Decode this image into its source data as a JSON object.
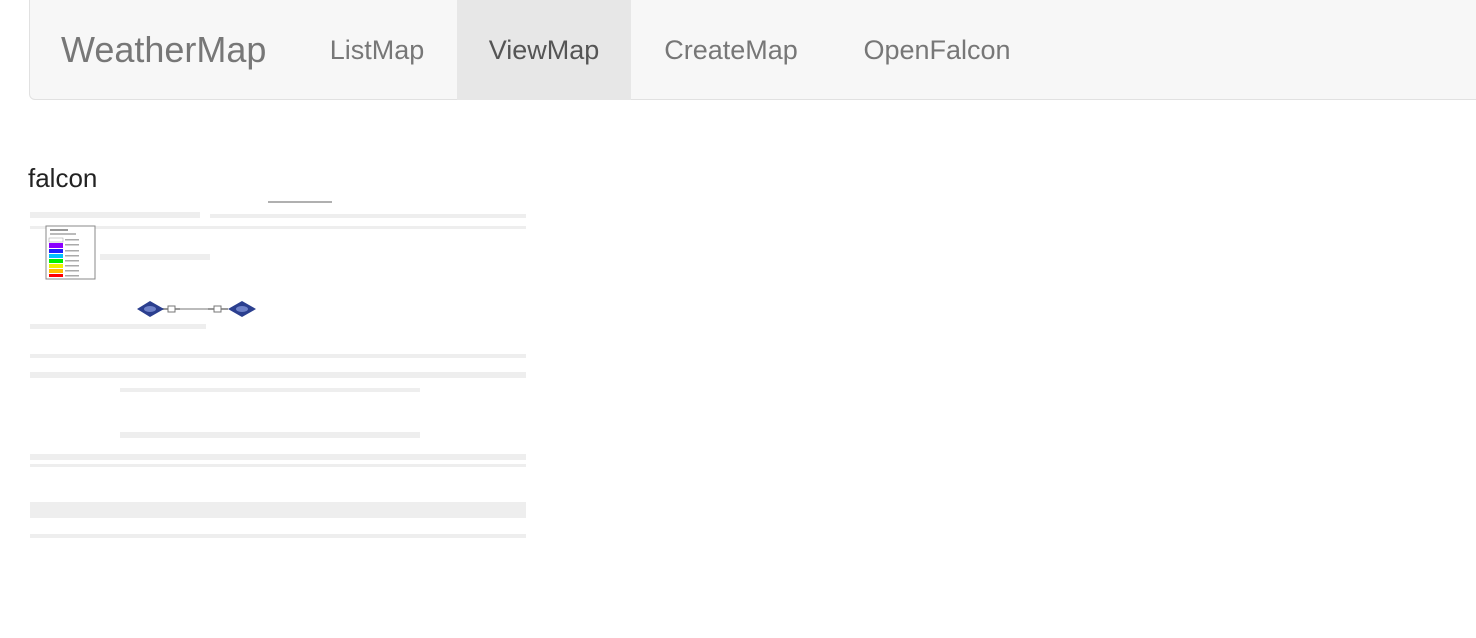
{
  "navbar": {
    "brand": "WeatherMap",
    "items": [
      {
        "label": "ListMap",
        "active": false
      },
      {
        "label": "ViewMap",
        "active": true
      },
      {
        "label": "CreateMap",
        "active": false
      },
      {
        "label": "OpenFalcon",
        "active": false
      }
    ],
    "background": "#f7f7f7",
    "active_background": "#e7e7e7"
  },
  "page": {
    "title": "falcon"
  },
  "map": {
    "legend_swatch_colors": [
      "#ffffff",
      "#8c00ff",
      "#2020ff",
      "#00c0ff",
      "#00f000",
      "#f0f000",
      "#ffc000",
      "#ff0000"
    ],
    "node_color": "#2b3f8f"
  }
}
